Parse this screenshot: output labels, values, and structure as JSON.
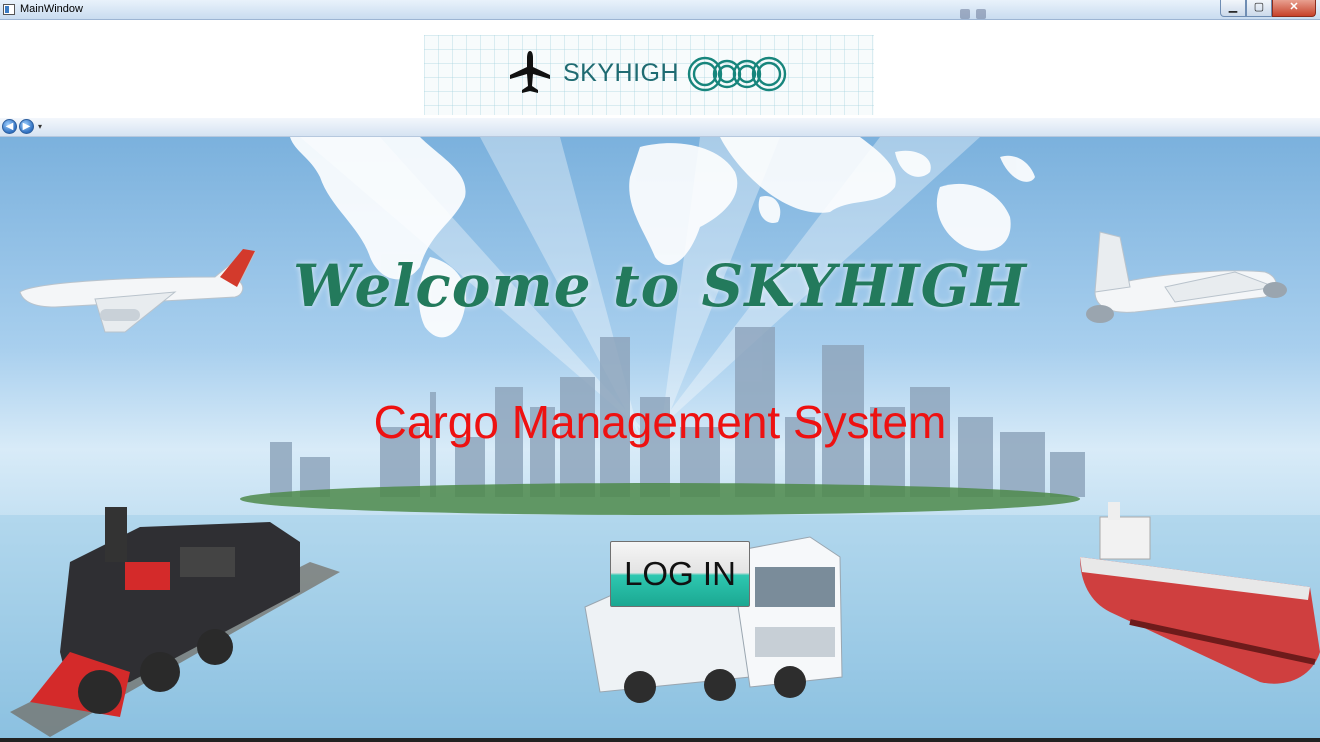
{
  "window": {
    "title": "MainWindow",
    "controls": {
      "minimize": "▁",
      "maximize": "▢",
      "close": "✕"
    }
  },
  "header": {
    "logo_text": "SKYHIGH",
    "logo_icons": [
      "airplane-icon",
      "rings-logo-icon"
    ]
  },
  "navigation": {
    "back_icon": "back-arrow-icon",
    "forward_icon": "forward-arrow-icon",
    "back": "◀",
    "forward": "▶",
    "dropdown": "▾"
  },
  "main": {
    "welcome_text": "Welcome to SKYHIGH",
    "subtitle": "Cargo Management System",
    "login_label": "LOG IN"
  },
  "colors": {
    "welcome": "#237a5c",
    "subtitle": "#ee1111",
    "logo_text": "#1f6b72",
    "login_button_bottom": "#1ba892"
  }
}
